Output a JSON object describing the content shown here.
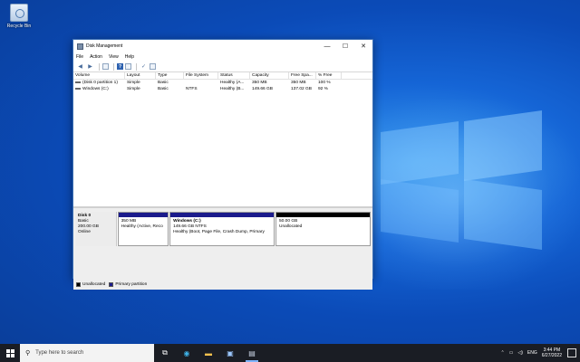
{
  "desktop": {
    "recycle_bin_label": "Recycle Bin"
  },
  "window": {
    "title": "Disk Management",
    "minimize": "—",
    "maximize": "☐",
    "close": "✕",
    "menu": [
      "File",
      "Action",
      "View",
      "Help"
    ]
  },
  "volumes": {
    "columns": [
      "Volume",
      "Layout",
      "Type",
      "File System",
      "Status",
      "Capacity",
      "Free Spa...",
      "% Free"
    ],
    "rows": [
      [
        "(Disk 0 partition 1)",
        "Simple",
        "Basic",
        "",
        "Healthy (A...",
        "350 MB",
        "350 MB",
        "100 %"
      ],
      [
        "Windows (C:)",
        "Simple",
        "Basic",
        "NTFS",
        "Healthy (B...",
        "149.66 GB",
        "137.02 GB",
        "92 %"
      ]
    ]
  },
  "disk": {
    "name": "Disk 0",
    "type": "Basic",
    "size": "200.00 GB",
    "status": "Online",
    "partitions": [
      {
        "title": "",
        "size": "350 MB",
        "status": "Healthy (Active, Reco"
      },
      {
        "title": "Windows  (C:)",
        "size": "149.66 GB NTFS",
        "status": "Healthy (Boot, Page File, Crash Dump, Primary"
      },
      {
        "title": "",
        "size": "50.00 GB",
        "status": "Unallocated"
      }
    ]
  },
  "legend": {
    "unallocated": "Unallocated",
    "primary": "Primary partition"
  },
  "taskbar": {
    "search_placeholder": "Type here to search",
    "lang": "ENG",
    "time": "3:44 PM",
    "date": "6/27/2022"
  },
  "colors": {
    "primary_partition": "#1b1b8c",
    "unallocated": "#000000",
    "desktop_blue": "#0b4bb8"
  }
}
